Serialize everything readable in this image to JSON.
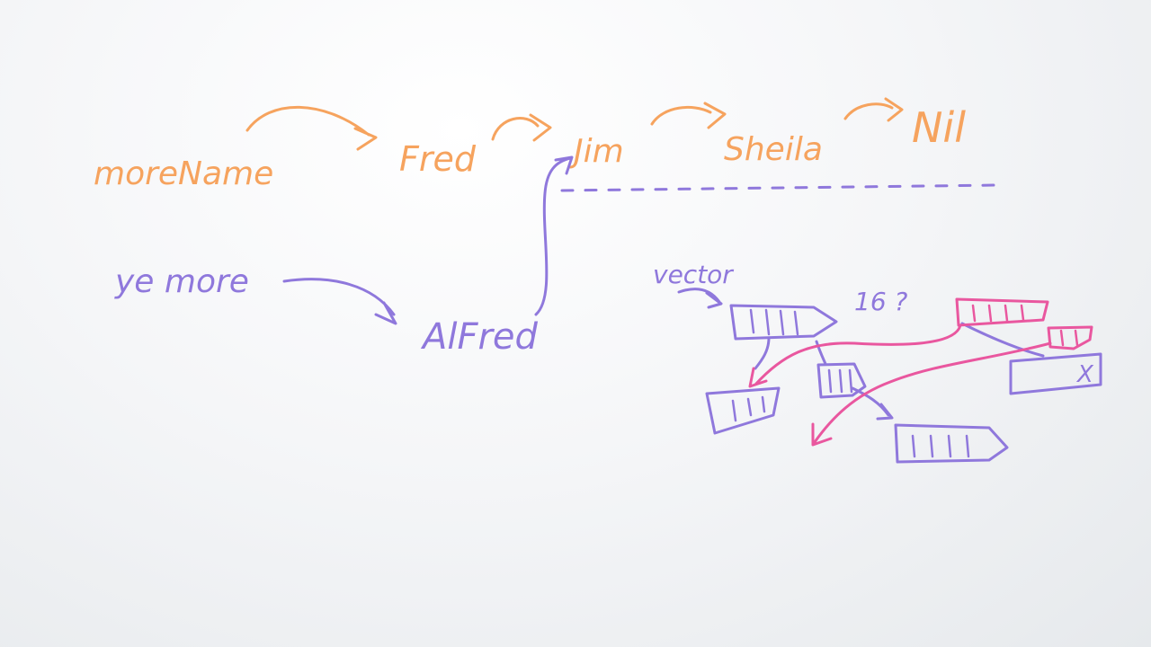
{
  "colors": {
    "orange": "#f6a35e",
    "purple": "#8f78dc",
    "pink": "#e9579f",
    "board": "#f4f5f7"
  },
  "labels": {
    "more_name": "moreName",
    "fred": "Fred",
    "jim": "Jim",
    "sheila": "Sheila",
    "nil": "Nil",
    "ye_more": "ye more",
    "alfred": "AlFred",
    "vector": "vector",
    "question": "16 ?",
    "x_mark": "X"
  }
}
